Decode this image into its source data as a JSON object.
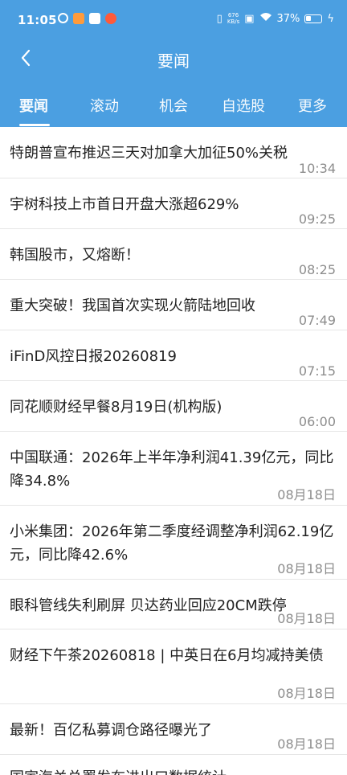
{
  "status_bar": {
    "time": "11:05",
    "net_speed_value": "676",
    "net_speed_unit": "KB/s",
    "battery": "37%",
    "battery_level": 0.37
  },
  "nav": {
    "back_icon": "chevron-left-icon",
    "title": "要闻"
  },
  "tabs": [
    {
      "label": "要闻",
      "active": true
    },
    {
      "label": "滚动",
      "active": false
    },
    {
      "label": "机会",
      "active": false
    },
    {
      "label": "自选股",
      "active": false
    },
    {
      "label": "更多",
      "active": false
    }
  ],
  "news": [
    {
      "title": "特朗普宣布推迟三天对加拿大加征50%关税",
      "time": "10:34"
    },
    {
      "title": "宇树科技上市首日开盘大涨超629%",
      "time": "09:25"
    },
    {
      "title": "韩国股市，又熔断！",
      "time": "08:25"
    },
    {
      "title": "重大突破！我国首次实现火箭陆地回收",
      "time": "07:49"
    },
    {
      "title": "iFinD风控日报20260819",
      "time": "07:15"
    },
    {
      "title": "同花顺财经早餐8月19日(机构版)",
      "time": "06:00"
    },
    {
      "title": "中国联通：2026年上半年净利润41.39亿元，同比降34.8%",
      "time": "08月18日"
    },
    {
      "title": "小米集团：2026年第二季度经调整净利润62.19亿元，同比降42.6%",
      "time": "08月18日"
    },
    {
      "title": "眼科管线失利刷屏 贝达药业回应20CM跌停",
      "time": "08月18日"
    },
    {
      "title": "财经下午茶20260818 | 中英日在6月均减持美债",
      "time": "08月18日"
    },
    {
      "title": "最新！百亿私募调仓路径曝光了",
      "time": "08月18日"
    },
    {
      "title": "国家海关总署发布进出口数据统计",
      "time": ""
    }
  ]
}
